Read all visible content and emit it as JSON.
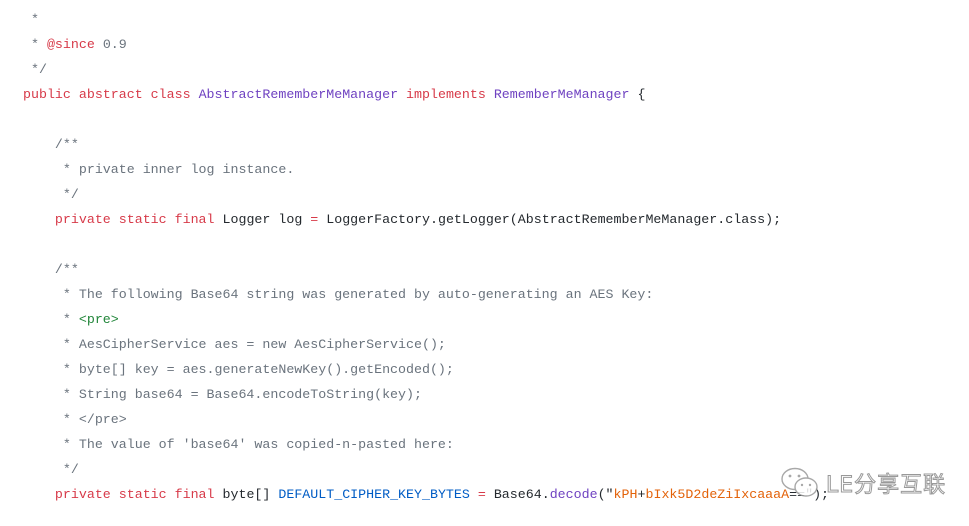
{
  "code_lines": [
    [],
    [
      {
        "t": " *",
        "c": "cm"
      }
    ],
    [
      {
        "t": " * ",
        "c": "cm"
      },
      {
        "t": "@since",
        "c": "kw"
      },
      {
        "t": " 0.9",
        "c": "cm"
      }
    ],
    [
      {
        "t": " */",
        "c": "cm"
      }
    ],
    [
      {
        "t": "public abstract class ",
        "c": "kw"
      },
      {
        "t": "AbstractRememberMeManager",
        "c": "cls"
      },
      {
        "t": " implements ",
        "c": "kw"
      },
      {
        "t": "RememberMeManager",
        "c": "cls"
      },
      {
        "t": " {",
        "c": "pl"
      }
    ],
    [],
    [
      {
        "t": "    /**",
        "c": "cm"
      }
    ],
    [
      {
        "t": "     * private inner log instance.",
        "c": "cm"
      }
    ],
    [
      {
        "t": "     */",
        "c": "cm"
      }
    ],
    [
      {
        "t": "    private static final ",
        "c": "kw"
      },
      {
        "t": "Logger log ",
        "c": "pl"
      },
      {
        "t": "=",
        "c": "op"
      },
      {
        "t": " LoggerFactory.",
        "c": "pl"
      },
      {
        "t": "getLogger",
        "c": "pl"
      },
      {
        "t": "(AbstractRememberMeManager.class);",
        "c": "pl"
      }
    ],
    [],
    [
      {
        "t": "    /**",
        "c": "cm"
      }
    ],
    [
      {
        "t": "     * The following Base64 string was generated by auto-generating an AES Key:",
        "c": "cm"
      }
    ],
    [
      {
        "t": "     * ",
        "c": "cm"
      },
      {
        "t": "<pre>",
        "c": "tag"
      }
    ],
    [
      {
        "t": "     * AesCipherService aes = new AesCipherService();",
        "c": "cm"
      }
    ],
    [
      {
        "t": "     * byte[] key = aes.generateNewKey().getEncoded();",
        "c": "cm"
      }
    ],
    [
      {
        "t": "     * String base64 = Base64.encodeToString(key);",
        "c": "cm"
      }
    ],
    [
      {
        "t": "     * </pre>",
        "c": "cm"
      }
    ],
    [
      {
        "t": "     * The value of 'base64' was copied-n-pasted here:",
        "c": "cm"
      }
    ],
    [
      {
        "t": "     */",
        "c": "cm"
      }
    ],
    [
      {
        "t": "    private static final ",
        "c": "kw"
      },
      {
        "t": "byte[] ",
        "c": "pl"
      },
      {
        "t": "DEFAULT_CIPHER_KEY_BYTES",
        "c": "const"
      },
      {
        "t": " = ",
        "c": "op"
      },
      {
        "t": "Base64.",
        "c": "pl"
      },
      {
        "t": "decode",
        "c": "fn"
      },
      {
        "t": "(\"",
        "c": "pl"
      },
      {
        "t": "kPH",
        "c": "str"
      },
      {
        "t": "+",
        "c": "pl"
      },
      {
        "t": "bIxk5D2deZiIxcaaaA",
        "c": "str"
      },
      {
        "t": "==\");",
        "c": "pl"
      }
    ]
  ],
  "watermark": {
    "icon": "wechat-icon",
    "text": "LE分享互联"
  }
}
